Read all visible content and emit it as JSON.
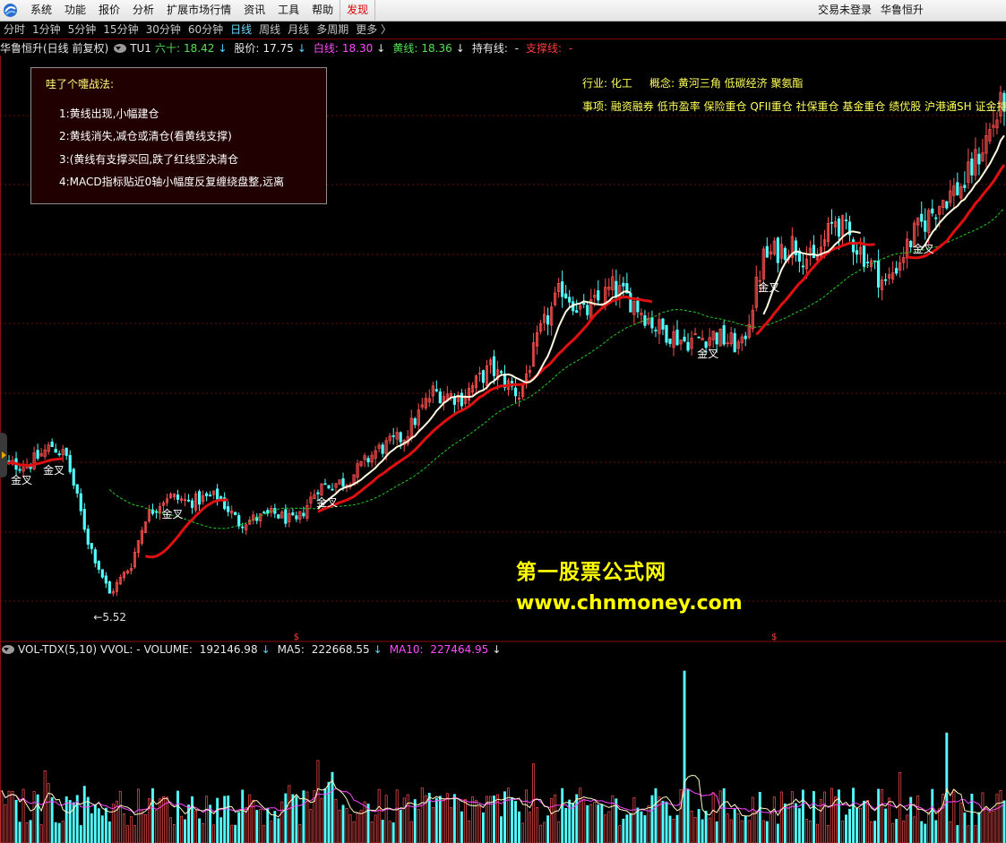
{
  "menubar": {
    "items": [
      "系统",
      "功能",
      "报价",
      "分析",
      "扩展市场行情",
      "资讯",
      "工具",
      "帮助",
      "发现"
    ],
    "active_item": "发现",
    "login_status": "交易未登录",
    "stock_name": "华鲁恒升"
  },
  "periods": {
    "items": [
      "分时",
      "1分钟",
      "5分钟",
      "15分钟",
      "30分钟",
      "60分钟",
      "日线",
      "周线",
      "月线",
      "多周期",
      "更多 〉"
    ],
    "active": "日线"
  },
  "main_header": {
    "stock": "华鲁恒升(日线 前复权)",
    "indicator": "TU1",
    "liushi_label": "六十:",
    "liushi_value": "18.42",
    "price_label": "股价:",
    "price_value": "17.75",
    "white_label": "白线:",
    "white_value": "18.30",
    "yellow_label": "黄线:",
    "yellow_value": "18.36",
    "hold_label": "持有线:",
    "hold_value": "-",
    "support_label": "支撑线:",
    "support_value": "-"
  },
  "strategy_box": {
    "title": "哇了个嚏战法:",
    "lines": [
      "1:黄线出现,小幅建仓",
      "2:黄线消失,减仓或清仓(看黄线支撑)",
      "3:(黄线有支撑买回,跌了红线坚决清仓",
      "4:MACD指标贴近0轴小幅度反复缠绕盘整,远离"
    ]
  },
  "stock_info": {
    "industry_label": "行业:",
    "industry": "化工",
    "concept_label": "概念:",
    "concept": "黄河三角 低碳经济 聚氨酯",
    "events_label": "事项:",
    "events": "融资融券 低市盈率 保险重仓 QFII重仓 社保重仓 基金重仓 绩优股 沪港通SH 证金持股"
  },
  "chart_annotations": {
    "cross_label": "金叉",
    "low_marker": "5.52",
    "dividend_marker": "$"
  },
  "watermark": {
    "line1": "第一股票公式网",
    "line2": "www.chnmoney.com"
  },
  "volume_header": {
    "indicator": "VOL-TDX(5,10)",
    "vvol": "VVOL: -",
    "volume_label": "VOLUME:",
    "volume_value": "192146.98",
    "ma5_label": "MA5:",
    "ma5_value": "222668.55",
    "ma10_label": "MA10:",
    "ma10_value": "227464.95"
  },
  "colors": {
    "background": "#000000",
    "up_candle": "#ff5050",
    "down_candle": "#54ffff",
    "white_line": "#ffffff",
    "yellow_line": "#ffff66",
    "red_line": "#e01010",
    "support_line": "#22cc22",
    "grid": "#6a1010",
    "volume_ma5": "#ffffff",
    "volume_ma10": "#ff44ff"
  },
  "chart_data": {
    "type": "candlestick",
    "price_trend": [
      {
        "i": 0,
        "p": 10.5
      },
      {
        "i": 8,
        "p": 10.6
      },
      {
        "i": 14,
        "p": 11.2
      },
      {
        "i": 18,
        "p": 10.8
      },
      {
        "i": 24,
        "p": 8.0
      },
      {
        "i": 30,
        "p": 6.2
      },
      {
        "i": 36,
        "p": 7.2
      },
      {
        "i": 40,
        "p": 8.8
      },
      {
        "i": 46,
        "p": 9.5
      },
      {
        "i": 52,
        "p": 9.3
      },
      {
        "i": 60,
        "p": 9.5
      },
      {
        "i": 66,
        "p": 8.6
      },
      {
        "i": 76,
        "p": 8.9
      },
      {
        "i": 82,
        "p": 8.6
      },
      {
        "i": 88,
        "p": 9.8
      },
      {
        "i": 96,
        "p": 10.0
      },
      {
        "i": 104,
        "p": 11.0
      },
      {
        "i": 112,
        "p": 11.5
      },
      {
        "i": 120,
        "p": 13.0
      },
      {
        "i": 128,
        "p": 12.8
      },
      {
        "i": 136,
        "p": 13.8
      },
      {
        "i": 144,
        "p": 12.9
      },
      {
        "i": 150,
        "p": 15.0
      },
      {
        "i": 156,
        "p": 16.5
      },
      {
        "i": 162,
        "p": 15.6
      },
      {
        "i": 170,
        "p": 16.5
      },
      {
        "i": 176,
        "p": 16.0
      },
      {
        "i": 182,
        "p": 15.2
      },
      {
        "i": 190,
        "p": 14.7
      },
      {
        "i": 198,
        "p": 14.9
      },
      {
        "i": 206,
        "p": 14.5
      },
      {
        "i": 212,
        "p": 17.5
      },
      {
        "i": 220,
        "p": 18.0
      },
      {
        "i": 226,
        "p": 17.3
      },
      {
        "i": 232,
        "p": 18.8
      },
      {
        "i": 240,
        "p": 17.6
      },
      {
        "i": 246,
        "p": 16.6
      },
      {
        "i": 254,
        "p": 18.3
      },
      {
        "i": 262,
        "p": 19.5
      },
      {
        "i": 268,
        "p": 20.0
      },
      {
        "i": 274,
        "p": 21.5
      },
      {
        "i": 279,
        "p": 22.8
      }
    ],
    "cross_points": [
      3,
      12,
      45,
      88,
      194,
      211,
      254
    ],
    "low_point": {
      "i": 27,
      "p": 5.52
    },
    "dividend_points": [
      82,
      215
    ],
    "volume_spikes": [
      {
        "i": 190,
        "v": 1.0
      },
      {
        "i": 263,
        "v": 0.64
      },
      {
        "i": 88,
        "v": 0.48
      },
      {
        "i": 148,
        "v": 0.46
      },
      {
        "i": 12,
        "v": 0.42
      }
    ]
  }
}
